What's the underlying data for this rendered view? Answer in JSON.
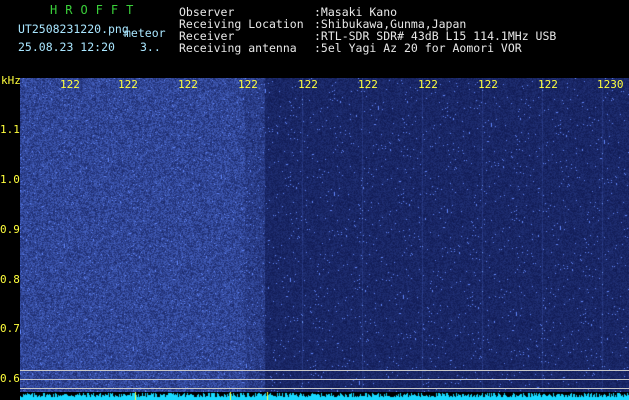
{
  "header": {
    "brand": "HROFFT",
    "filename": "UT2508231220.png",
    "tag": "meteor",
    "datetime": "25.08.23 12:20",
    "seq": "3..",
    "fields": [
      {
        "label": "Observer",
        "value": ":Masaki Kano"
      },
      {
        "label": "Receiving Location",
        "value": ":Shibukawa,Gunma,Japan"
      },
      {
        "label": "Receiver",
        "value": ":RTL-SDR SDR# 43dB L15 114.1MHz USB"
      },
      {
        "label": "Receiving antenna",
        "value": ":5el Yagi Az 20 for Aomori VOR"
      }
    ]
  },
  "axes": {
    "y_unit": "kHz",
    "y_ticks": [
      "1.1",
      "1.0",
      "0.9",
      "0.8",
      "0.7",
      "0.6"
    ],
    "x_ticks": [
      "122",
      "122",
      "122",
      "122",
      "122",
      "122",
      "122",
      "122",
      "122",
      "1230"
    ]
  },
  "colors": {
    "background": "#000000",
    "noise_low": "#0a1255",
    "noise_high": "#3f6cff",
    "tick_yellow": "#ffff3c",
    "strip_cyan": "#18d8ff"
  }
}
